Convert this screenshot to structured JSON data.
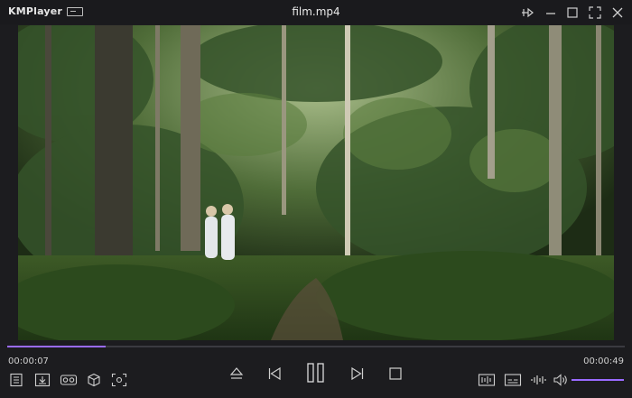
{
  "app": {
    "name": "KMPlayer",
    "file_title": "film.mp4"
  },
  "playback": {
    "elapsed": "00:00:07",
    "total": "00:00:49",
    "progress_fraction": 0.16,
    "volume_fraction": 1.0,
    "accent_color": "#9a6bff"
  },
  "titlebar_icons": [
    "mini-mode-icon",
    "pin-icon",
    "minimize-icon",
    "maximize-icon",
    "fullscreen-icon",
    "close-icon"
  ],
  "left_controls": [
    "playlist-icon",
    "download-icon",
    "vr-icon",
    "3d-cube-icon",
    "screen-capture-icon"
  ],
  "center_controls": [
    "eject-icon",
    "previous-icon",
    "pause-icon",
    "next-icon",
    "stop-icon"
  ],
  "right_controls": [
    "equalizer-icon",
    "subtitle-icon",
    "audio-wave-icon",
    "volume-icon"
  ]
}
